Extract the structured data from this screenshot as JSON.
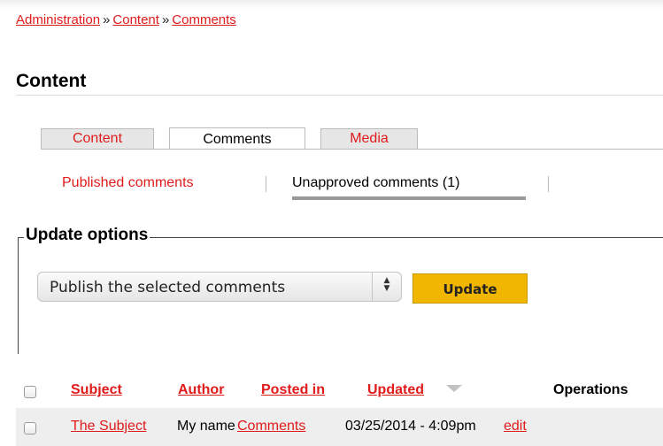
{
  "breadcrumb": {
    "items": [
      "Administration",
      "Content",
      "Comments"
    ],
    "separator": "»"
  },
  "page_title": "Content",
  "tabs": [
    {
      "label": "Content",
      "active": false
    },
    {
      "label": "Comments",
      "active": true
    },
    {
      "label": "Media",
      "active": false
    }
  ],
  "subtabs": {
    "published": "Published comments",
    "unapproved": "Unapproved comments (1)",
    "active": "unapproved"
  },
  "update_options": {
    "legend": "Update options",
    "select_value": "Publish the selected comments",
    "button_label": "Update"
  },
  "table": {
    "headers": {
      "subject": "Subject",
      "author": "Author",
      "posted_in": "Posted in",
      "updated": "Updated",
      "operations": "Operations"
    },
    "rows": [
      {
        "subject": "The Subject",
        "author": "My name",
        "posted_in": "Comments",
        "updated": "03/25/2014 - 4:09pm",
        "operation": "edit"
      }
    ]
  },
  "colors": {
    "link": "#e01b1b",
    "button": "#f1b600",
    "row_background": "#eeeeee"
  }
}
